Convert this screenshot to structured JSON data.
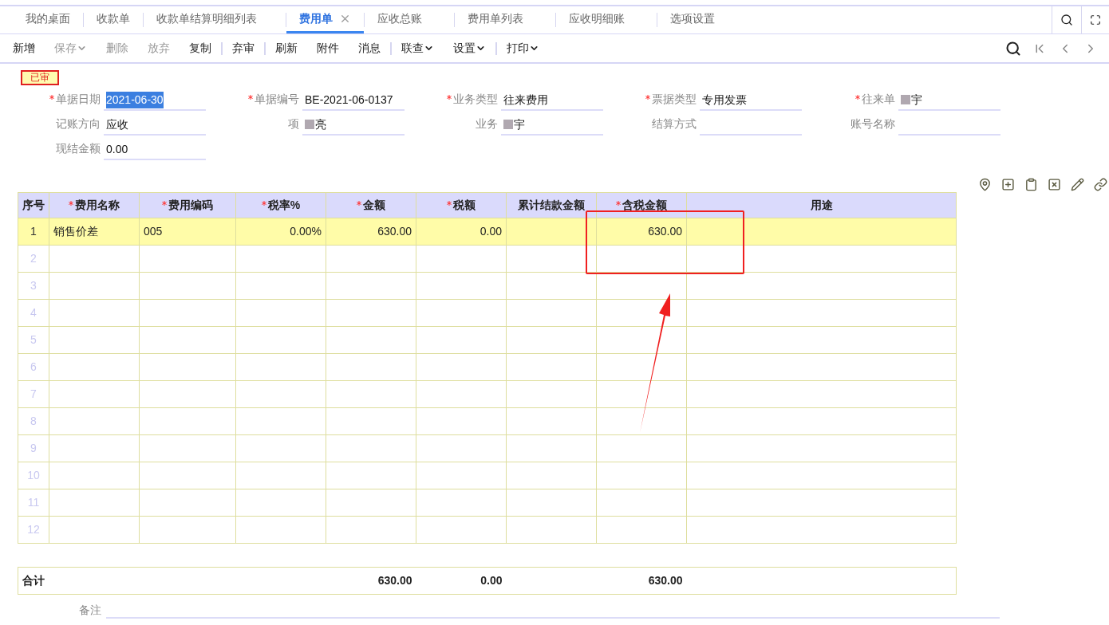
{
  "tabs": [
    {
      "label": "我的桌面",
      "selected": false,
      "closable": false
    },
    {
      "label": "收款单",
      "selected": false,
      "closable": false
    },
    {
      "label": "收款单结算明细列表",
      "selected": false,
      "closable": false
    },
    {
      "label": "费用单",
      "selected": true,
      "closable": true
    },
    {
      "label": "应收总账",
      "selected": false,
      "closable": false
    },
    {
      "label": "费用单列表",
      "selected": false,
      "closable": false
    },
    {
      "label": "应收明细账",
      "selected": false,
      "closable": false
    },
    {
      "label": "选项设置",
      "selected": false,
      "closable": false
    }
  ],
  "toolbar": [
    {
      "label": "新增",
      "disabled": false,
      "dropdown": false,
      "separator_after": false
    },
    {
      "label": "保存",
      "disabled": true,
      "dropdown": true,
      "separator_after": false
    },
    {
      "label": "删除",
      "disabled": true,
      "dropdown": false,
      "separator_after": false
    },
    {
      "label": "放弃",
      "disabled": true,
      "dropdown": false,
      "separator_after": false
    },
    {
      "label": "复制",
      "disabled": false,
      "dropdown": false,
      "separator_after": true
    },
    {
      "label": "弃审",
      "disabled": false,
      "dropdown": false,
      "separator_after": true
    },
    {
      "label": "刷新",
      "disabled": false,
      "dropdown": false,
      "separator_after": false
    },
    {
      "label": "附件",
      "disabled": false,
      "dropdown": false,
      "separator_after": false
    },
    {
      "label": "消息",
      "disabled": false,
      "dropdown": false,
      "separator_after": true
    },
    {
      "label": "联查",
      "disabled": false,
      "dropdown": true,
      "separator_after": false
    },
    {
      "label": "设置",
      "disabled": false,
      "dropdown": true,
      "separator_after": true
    },
    {
      "label": "打印",
      "disabled": false,
      "dropdown": true,
      "separator_after": false
    }
  ],
  "status_tag": "已审",
  "form": [
    [
      {
        "label": "单据日期",
        "required": true,
        "value": "2021-06-30",
        "text_selected": true,
        "blurred": false
      },
      {
        "label": "单据编号",
        "required": true,
        "value": "BE-2021-06-0137",
        "blurred": false
      },
      {
        "label": "业务类型",
        "required": true,
        "value": "往来费用",
        "blurred": false
      },
      {
        "label": "票据类型",
        "required": true,
        "value": "专用发票",
        "blurred": false
      },
      {
        "label": "往来单",
        "required": true,
        "value": "宇",
        "blurred": true
      }
    ],
    [
      {
        "label": "记账方向",
        "required": false,
        "value": "应收",
        "blurred": false
      },
      {
        "label": "项",
        "required": false,
        "value": "亮",
        "blurred": true
      },
      {
        "label": "业务",
        "required": false,
        "value": "宇",
        "blurred": true
      },
      {
        "label": "结算方式",
        "required": false
      },
      {
        "label": "账号名称",
        "required": false
      }
    ],
    [
      {
        "label": "现结金额",
        "required": false,
        "value": "0.00",
        "blurred": false
      }
    ]
  ],
  "table": {
    "columns": [
      {
        "label": "序号",
        "required": false
      },
      {
        "label": "费用名称",
        "required": true
      },
      {
        "label": "费用编码",
        "required": true
      },
      {
        "label": "税率%",
        "required": true
      },
      {
        "label": "金额",
        "required": true
      },
      {
        "label": "税额",
        "required": true
      },
      {
        "label": "累计结款金额",
        "required": false
      },
      {
        "label": "含税金额",
        "required": true
      },
      {
        "label": "用途",
        "required": false
      }
    ],
    "rows": [
      {
        "selected": true,
        "index": "1",
        "name": "销售价差",
        "code": "005",
        "rate": "0.00%",
        "amount": "630.00",
        "tax": "0.00",
        "amount_with_tax": "630.00"
      },
      {
        "selected": false,
        "index": "2"
      },
      {
        "selected": false,
        "index": "3"
      },
      {
        "selected": false,
        "index": "4"
      },
      {
        "selected": false,
        "index": "5"
      },
      {
        "selected": false,
        "index": "6"
      },
      {
        "selected": false,
        "index": "7"
      },
      {
        "selected": false,
        "index": "8"
      },
      {
        "selected": false,
        "index": "9"
      },
      {
        "selected": false,
        "index": "10"
      },
      {
        "selected": false,
        "index": "11"
      },
      {
        "selected": false,
        "index": "12"
      }
    ],
    "totals": {
      "label": "合计",
      "amount": "630.00",
      "tax": "0.00",
      "amount_with_tax": "630.00"
    }
  },
  "remark_label": "备注"
}
